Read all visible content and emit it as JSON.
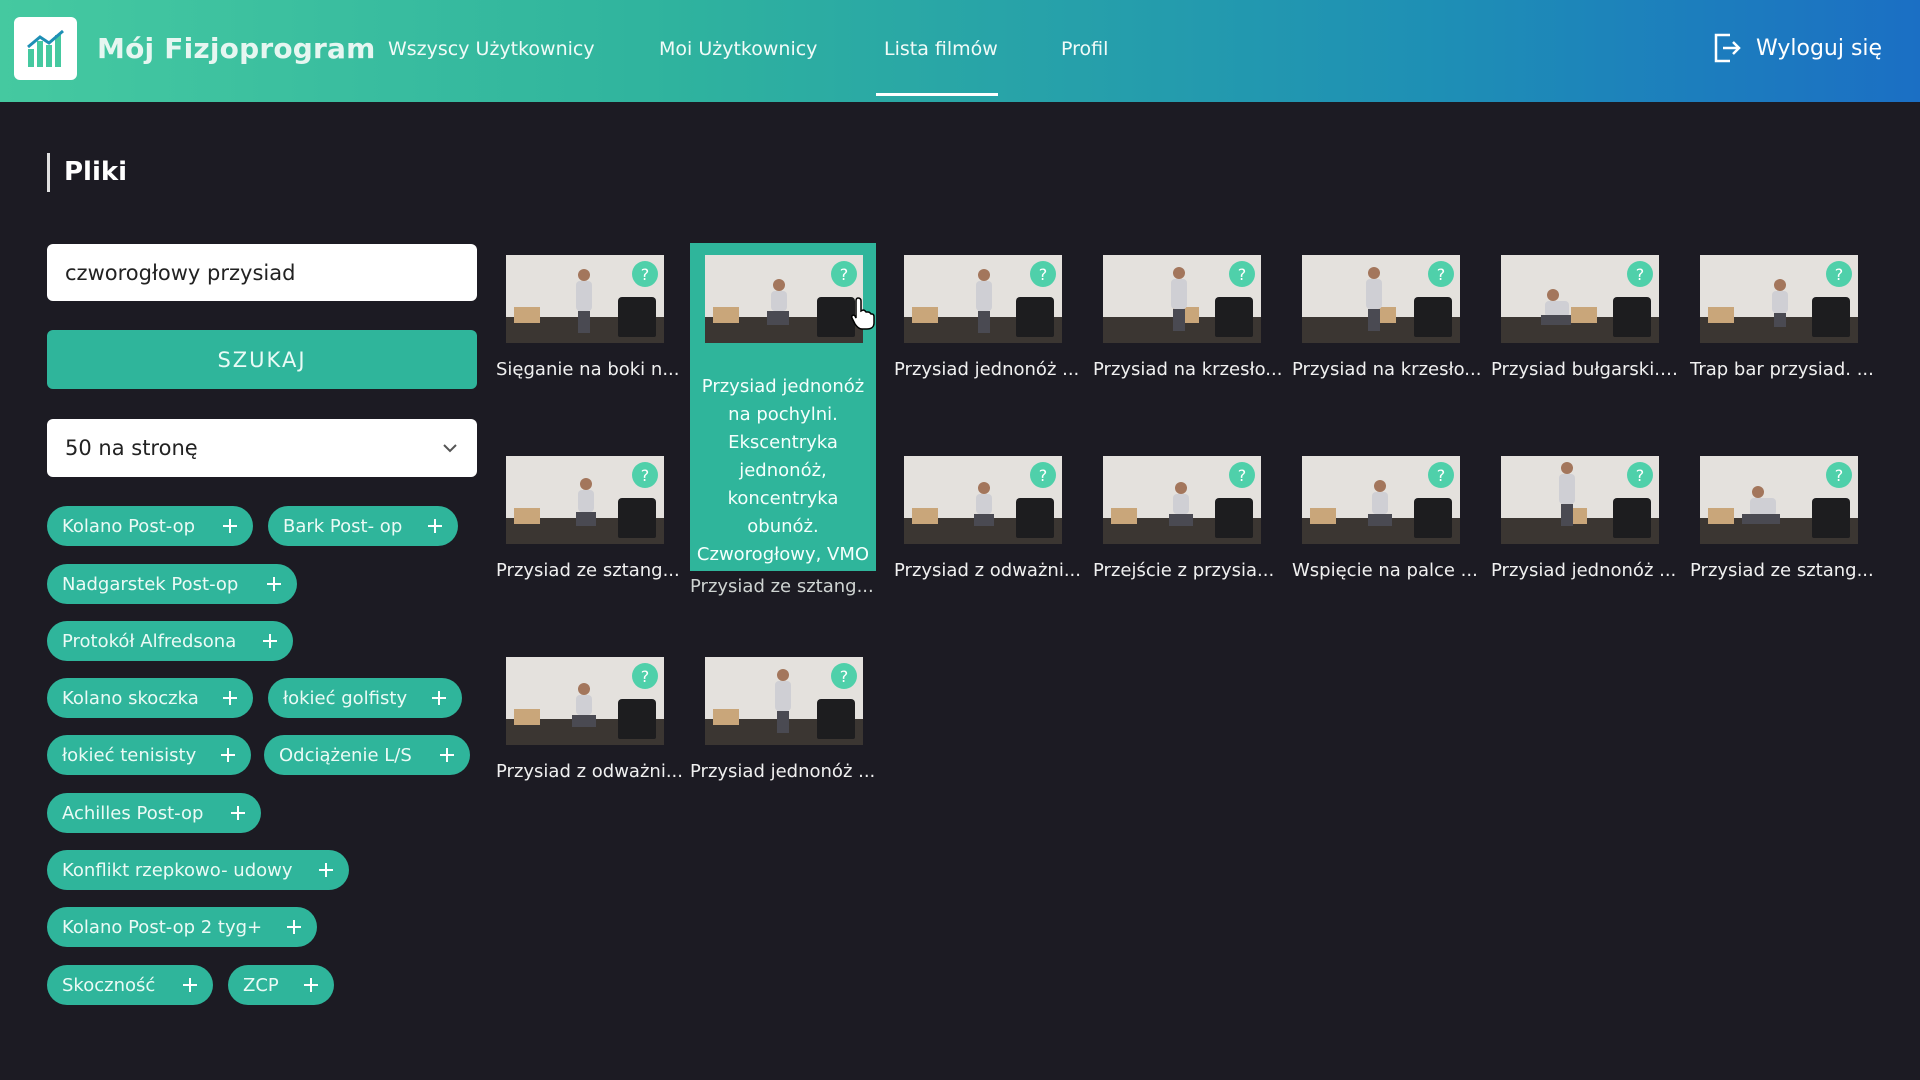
{
  "app": {
    "title": "Mój Fizjoprogram"
  },
  "nav": {
    "items": [
      {
        "label": "Wszyscy Użytkownicy",
        "active": false
      },
      {
        "label": "Moi Użytkownicy",
        "active": false
      },
      {
        "label": "Lista filmów",
        "active": true
      },
      {
        "label": "Profil",
        "active": false
      }
    ],
    "logout_label": "Wyloguj się"
  },
  "page": {
    "section_title": "Pliki"
  },
  "search": {
    "value": "czworogłowy przysiad",
    "button_label": "SZUKAJ"
  },
  "per_page": {
    "selected": "50 na stronę"
  },
  "tags": [
    "Kolano Post-op",
    "Bark Post- op",
    "Nadgarstek Post-op",
    "Protokół Alfredsona",
    "Kolano skoczka",
    "łokieć golfisty",
    "łokieć tenisisty",
    "Odciążenie L/S",
    "Achilles Post-op",
    "Konflikt rzepkowo- udowy",
    "Kolano Post-op 2 tyg+",
    "Skoczność",
    "ZCP"
  ],
  "videos": [
    {
      "label": "Sięganie na boki n..."
    },
    {
      "label": "Przysiad jednonóż na pochylni. Ekscentryka jednonóż, koncentryka obunóż. Czworogłowy, VMO",
      "active": true
    },
    {
      "label": "Przysiad jednonóż ..."
    },
    {
      "label": "Przysiad na krzesło..."
    },
    {
      "label": "Przysiad na krzesło..."
    },
    {
      "label": "Przysiad bułgarski. ..."
    },
    {
      "label": "Trap bar przysiad. ..."
    },
    {
      "label": "Przysiad ze sztang..."
    },
    {
      "label": "Przysiad ze sztang..."
    },
    {
      "label": "Przysiad z odważni..."
    },
    {
      "label": "Przejście z przysia..."
    },
    {
      "label": "Wspięcie na palce ..."
    },
    {
      "label": "Przysiad jednonóż ..."
    },
    {
      "label": "Przysiad ze sztang..."
    },
    {
      "label": "Przysiad z odważni..."
    },
    {
      "label": "Przysiad jednonóż ..."
    }
  ],
  "help_badge": "?",
  "colors": {
    "accent": "#2fb59b",
    "background": "#1c1b23"
  }
}
